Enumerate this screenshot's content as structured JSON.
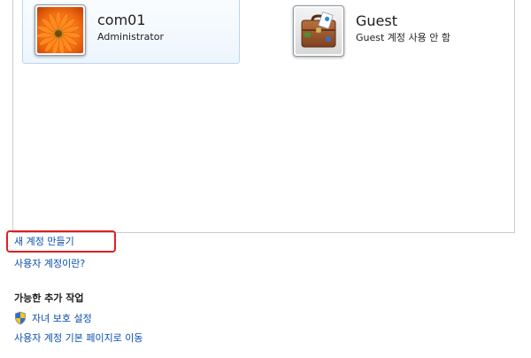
{
  "accounts": [
    {
      "name": "com01",
      "role": "Administrator",
      "avatar_icon": "flower-avatar-icon",
      "selected": true
    },
    {
      "name": "Guest",
      "role": "Guest 계정 사용 안 함",
      "avatar_icon": "briefcase-avatar-icon",
      "selected": false
    }
  ],
  "links": {
    "create_account": "새 계정 만들기",
    "what_is_account": "사용자 계정이란?"
  },
  "additional_tasks": {
    "heading": "가능한 추가 작업",
    "parental_controls": {
      "label": "자녀 보호 설정",
      "icon": "uac-shield-icon"
    },
    "main_page": "사용자 계정 기본 페이지로 이동"
  },
  "colors": {
    "link": "#0a4eaf",
    "highlight": "#e02020",
    "selected_tile_border": "#bcd6ee",
    "panel_border": "#c7ccd3"
  }
}
